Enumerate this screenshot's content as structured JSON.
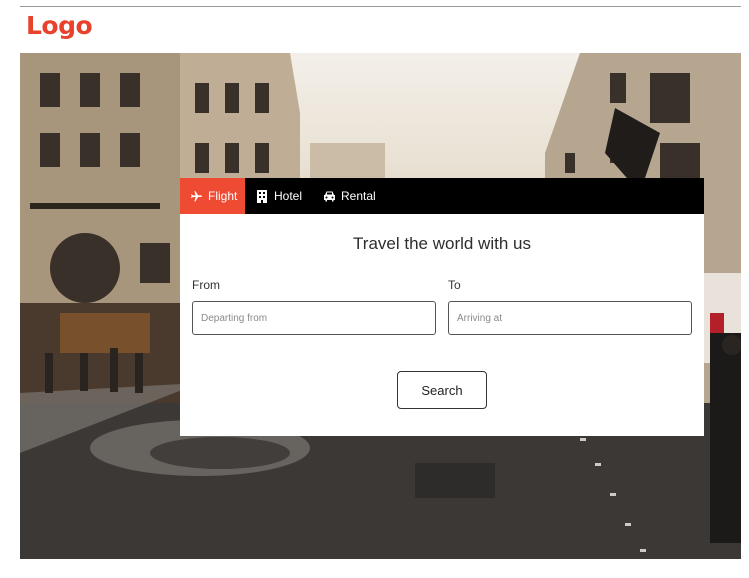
{
  "brand": {
    "logo_text": "Logo",
    "accent_color": "#ef4a32"
  },
  "search_panel": {
    "tabs": [
      {
        "label": "Flight",
        "icon": "airplane-icon",
        "active": true
      },
      {
        "label": "Hotel",
        "icon": "building-icon",
        "active": false
      },
      {
        "label": "Rental",
        "icon": "car-icon",
        "active": false
      }
    ],
    "heading": "Travel the world with us",
    "from": {
      "label": "From",
      "placeholder": "Departing from",
      "value": ""
    },
    "to": {
      "label": "To",
      "placeholder": "Arriving at",
      "value": ""
    },
    "search_button": "Search"
  },
  "hero": {
    "image": "city-street-photo"
  }
}
